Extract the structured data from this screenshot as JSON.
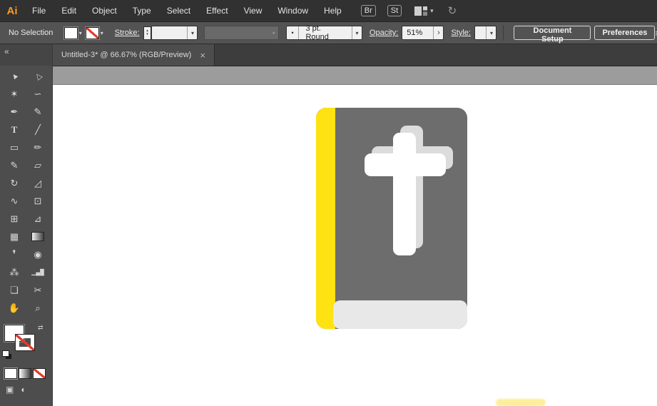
{
  "menubar": {
    "logo": "Ai",
    "logo_color": "#ff9a1e",
    "items": [
      "File",
      "Edit",
      "Object",
      "Type",
      "Select",
      "Effect",
      "View",
      "Window",
      "Help"
    ],
    "br_button": "Br",
    "st_button": "St"
  },
  "control_bar": {
    "selection_status": "No Selection",
    "stroke_label": "Stroke:",
    "stroke_weight_value": "",
    "brush_value": "3 pt. Round",
    "opacity_label": "Opacity:",
    "opacity_value": "51%",
    "style_label": "Style:",
    "document_setup_button": "Document Setup",
    "preferences_button": "Preferences"
  },
  "document_tab": {
    "title": "Untitled-3* @ 66.67% (RGB/Preview)"
  },
  "toolbar": {
    "tools": [
      {
        "name": "selection-tool",
        "glyph": "▲"
      },
      {
        "name": "direct-selection-tool",
        "glyph": "△"
      },
      {
        "name": "magic-wand-tool",
        "glyph": "✶"
      },
      {
        "name": "lasso-tool",
        "glyph": "∽"
      },
      {
        "name": "pen-tool",
        "glyph": "✒"
      },
      {
        "name": "curvature-tool",
        "glyph": "✎"
      },
      {
        "name": "type-tool",
        "glyph": "T"
      },
      {
        "name": "line-segment-tool",
        "glyph": "╱"
      },
      {
        "name": "rectangle-tool",
        "glyph": "▭"
      },
      {
        "name": "paintbrush-tool",
        "glyph": "✏"
      },
      {
        "name": "pencil-tool",
        "glyph": "✎"
      },
      {
        "name": "eraser-tool",
        "glyph": "▱"
      },
      {
        "name": "rotate-tool",
        "glyph": "↻"
      },
      {
        "name": "scale-tool",
        "glyph": "◿"
      },
      {
        "name": "width-tool",
        "glyph": "∿"
      },
      {
        "name": "free-transform-tool",
        "glyph": "⊡"
      },
      {
        "name": "shape-builder-tool",
        "glyph": "⊞"
      },
      {
        "name": "perspective-grid-tool",
        "glyph": "⊿"
      },
      {
        "name": "mesh-tool",
        "glyph": "▦"
      },
      {
        "name": "gradient-tool",
        "glyph": ""
      },
      {
        "name": "eyedropper-tool",
        "glyph": "❜"
      },
      {
        "name": "blend-tool",
        "glyph": "◉"
      },
      {
        "name": "symbol-sprayer-tool",
        "glyph": "⁂"
      },
      {
        "name": "column-graph-tool",
        "glyph": "▁▄█"
      },
      {
        "name": "artboard-tool",
        "glyph": "❏"
      },
      {
        "name": "slice-tool",
        "glyph": "✂"
      },
      {
        "name": "hand-tool",
        "glyph": "✋"
      },
      {
        "name": "zoom-tool",
        "glyph": "⌕"
      }
    ]
  },
  "icons": {
    "chevron_down": "▾",
    "chevron_right": "›",
    "stepper_up": "▴",
    "stepper_down": "▾",
    "sync": "↻",
    "collapse": "«",
    "swap": "⇄",
    "close": "×",
    "panel_menu": "≡",
    "brush_dot": "•",
    "draw_mode": "▣",
    "screen_mode": "◐"
  },
  "colors": {
    "none_slash_red": "#e23b2e",
    "ui_dark": "#313131",
    "ui_medium": "#535353"
  },
  "canvas": {
    "pasteboard_color": "#9c9c9c",
    "artboard_color": "#ffffff"
  },
  "artwork": {
    "name": "bible-flat-icon",
    "cover_color": "#6d6d6d",
    "spine_color": "#ffe212",
    "pages_color": "#e8e8e8",
    "cross_front_color": "#ffffff",
    "cross_back_color": "#dcdcdc"
  }
}
